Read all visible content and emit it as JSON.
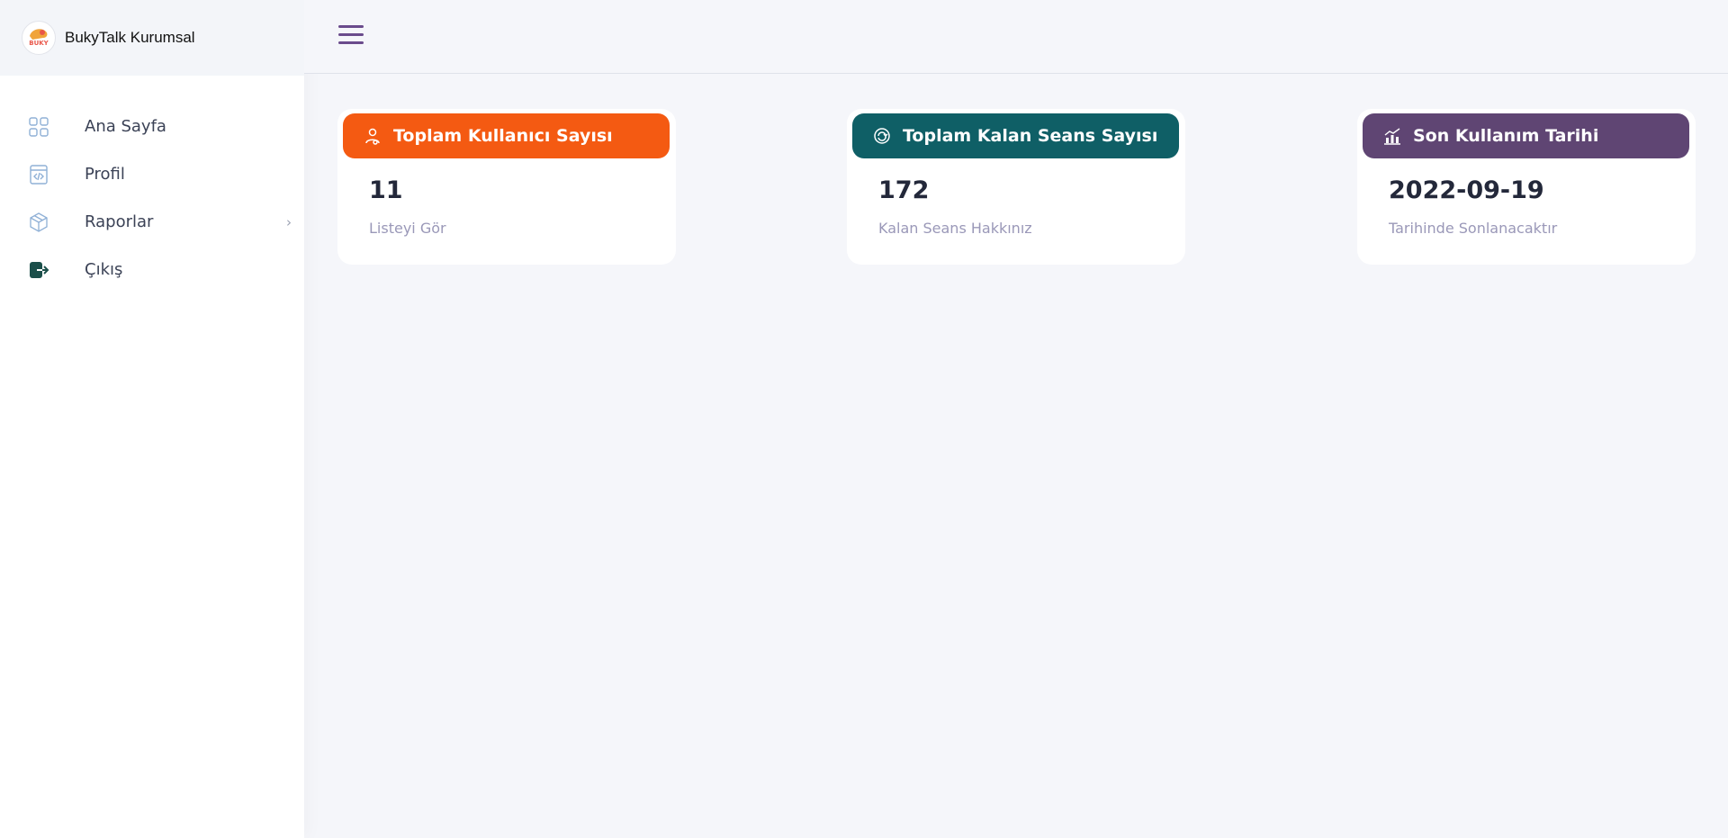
{
  "brand": {
    "name": "BukyTalk Kurumsal",
    "logo_text": "BUKY"
  },
  "sidebar": {
    "items": [
      {
        "label": "Ana Sayfa",
        "icon": "grid-icon"
      },
      {
        "label": "Profil",
        "icon": "code-file-icon"
      },
      {
        "label": "Raporlar",
        "icon": "cube-icon",
        "has_submenu": true
      },
      {
        "label": "Çıkış",
        "icon": "logout-icon"
      }
    ]
  },
  "topbar": {
    "menu_icon": "hamburger-icon"
  },
  "cards": [
    {
      "title": "Toplam Kullanıcı Sayısı",
      "value": "11",
      "subtitle": "Listeyi Gör",
      "color": "#f45a12",
      "icon": "user-icon"
    },
    {
      "title": "Toplam Kalan Seans Sayısı",
      "value": "172",
      "subtitle": "Kalan Seans Hakkınız",
      "color": "#0f5f66",
      "icon": "refresh-icon"
    },
    {
      "title": "Son Kullanım Tarihi",
      "value": "2022-09-19",
      "subtitle": "Tarihinde Sonlanacaktır",
      "color": "#5f4573",
      "icon": "chart-icon"
    }
  ]
}
